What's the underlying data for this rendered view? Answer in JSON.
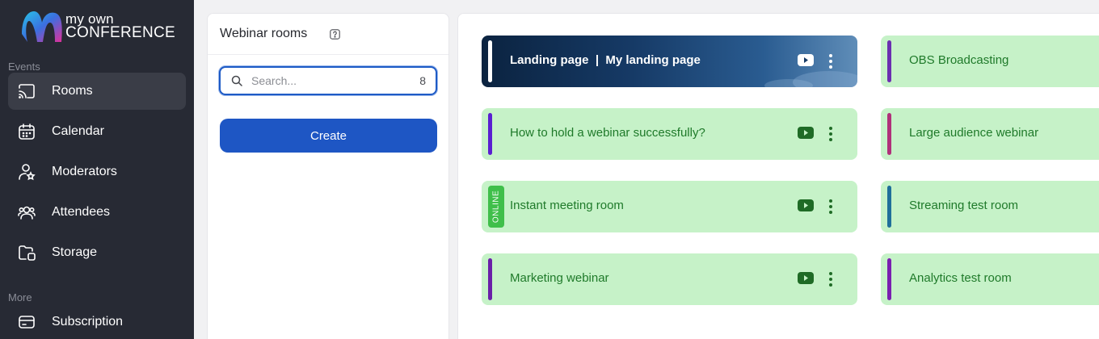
{
  "brand": {
    "line1": "my own",
    "line2": "CONFERENCE"
  },
  "sidebar": {
    "sections": [
      {
        "label": "Events"
      },
      {
        "label": "More"
      }
    ],
    "items": [
      {
        "label": "Rooms",
        "icon": "cast-icon",
        "active": true
      },
      {
        "label": "Calendar",
        "icon": "calendar-icon"
      },
      {
        "label": "Moderators",
        "icon": "moderator-icon"
      },
      {
        "label": "Attendees",
        "icon": "attendees-icon"
      },
      {
        "label": "Storage",
        "icon": "storage-icon"
      },
      {
        "label": "Subscription",
        "icon": "card-icon"
      }
    ]
  },
  "panel": {
    "title": "Webinar rooms",
    "search_placeholder": "Search...",
    "search_count": "8",
    "create_label": "Create"
  },
  "rooms": [
    {
      "title": "Landing page  |  My landing page",
      "bar_color": "#ffffff",
      "hero": true
    },
    {
      "title": "OBS Broadcasting",
      "bar_color": "#6b2fb0"
    },
    {
      "title": "How to hold a webinar successfully?",
      "bar_color": "#5a1fd1"
    },
    {
      "title": "Large audience webinar",
      "bar_color": "#b0307a"
    },
    {
      "title": "Instant meeting room",
      "online": "ONLINE"
    },
    {
      "title": "Streaming test room",
      "bar_color": "#1f6f9a"
    },
    {
      "title": "Marketing webinar",
      "bar_color": "#6a1fa8"
    },
    {
      "title": "Analytics test room",
      "bar_color": "#7a1fb0"
    }
  ],
  "colors": {
    "accent": "#1e56c4",
    "card_bg": "#c6f2c8",
    "card_text": "#1f7a2a",
    "online": "#3fbf4a"
  }
}
